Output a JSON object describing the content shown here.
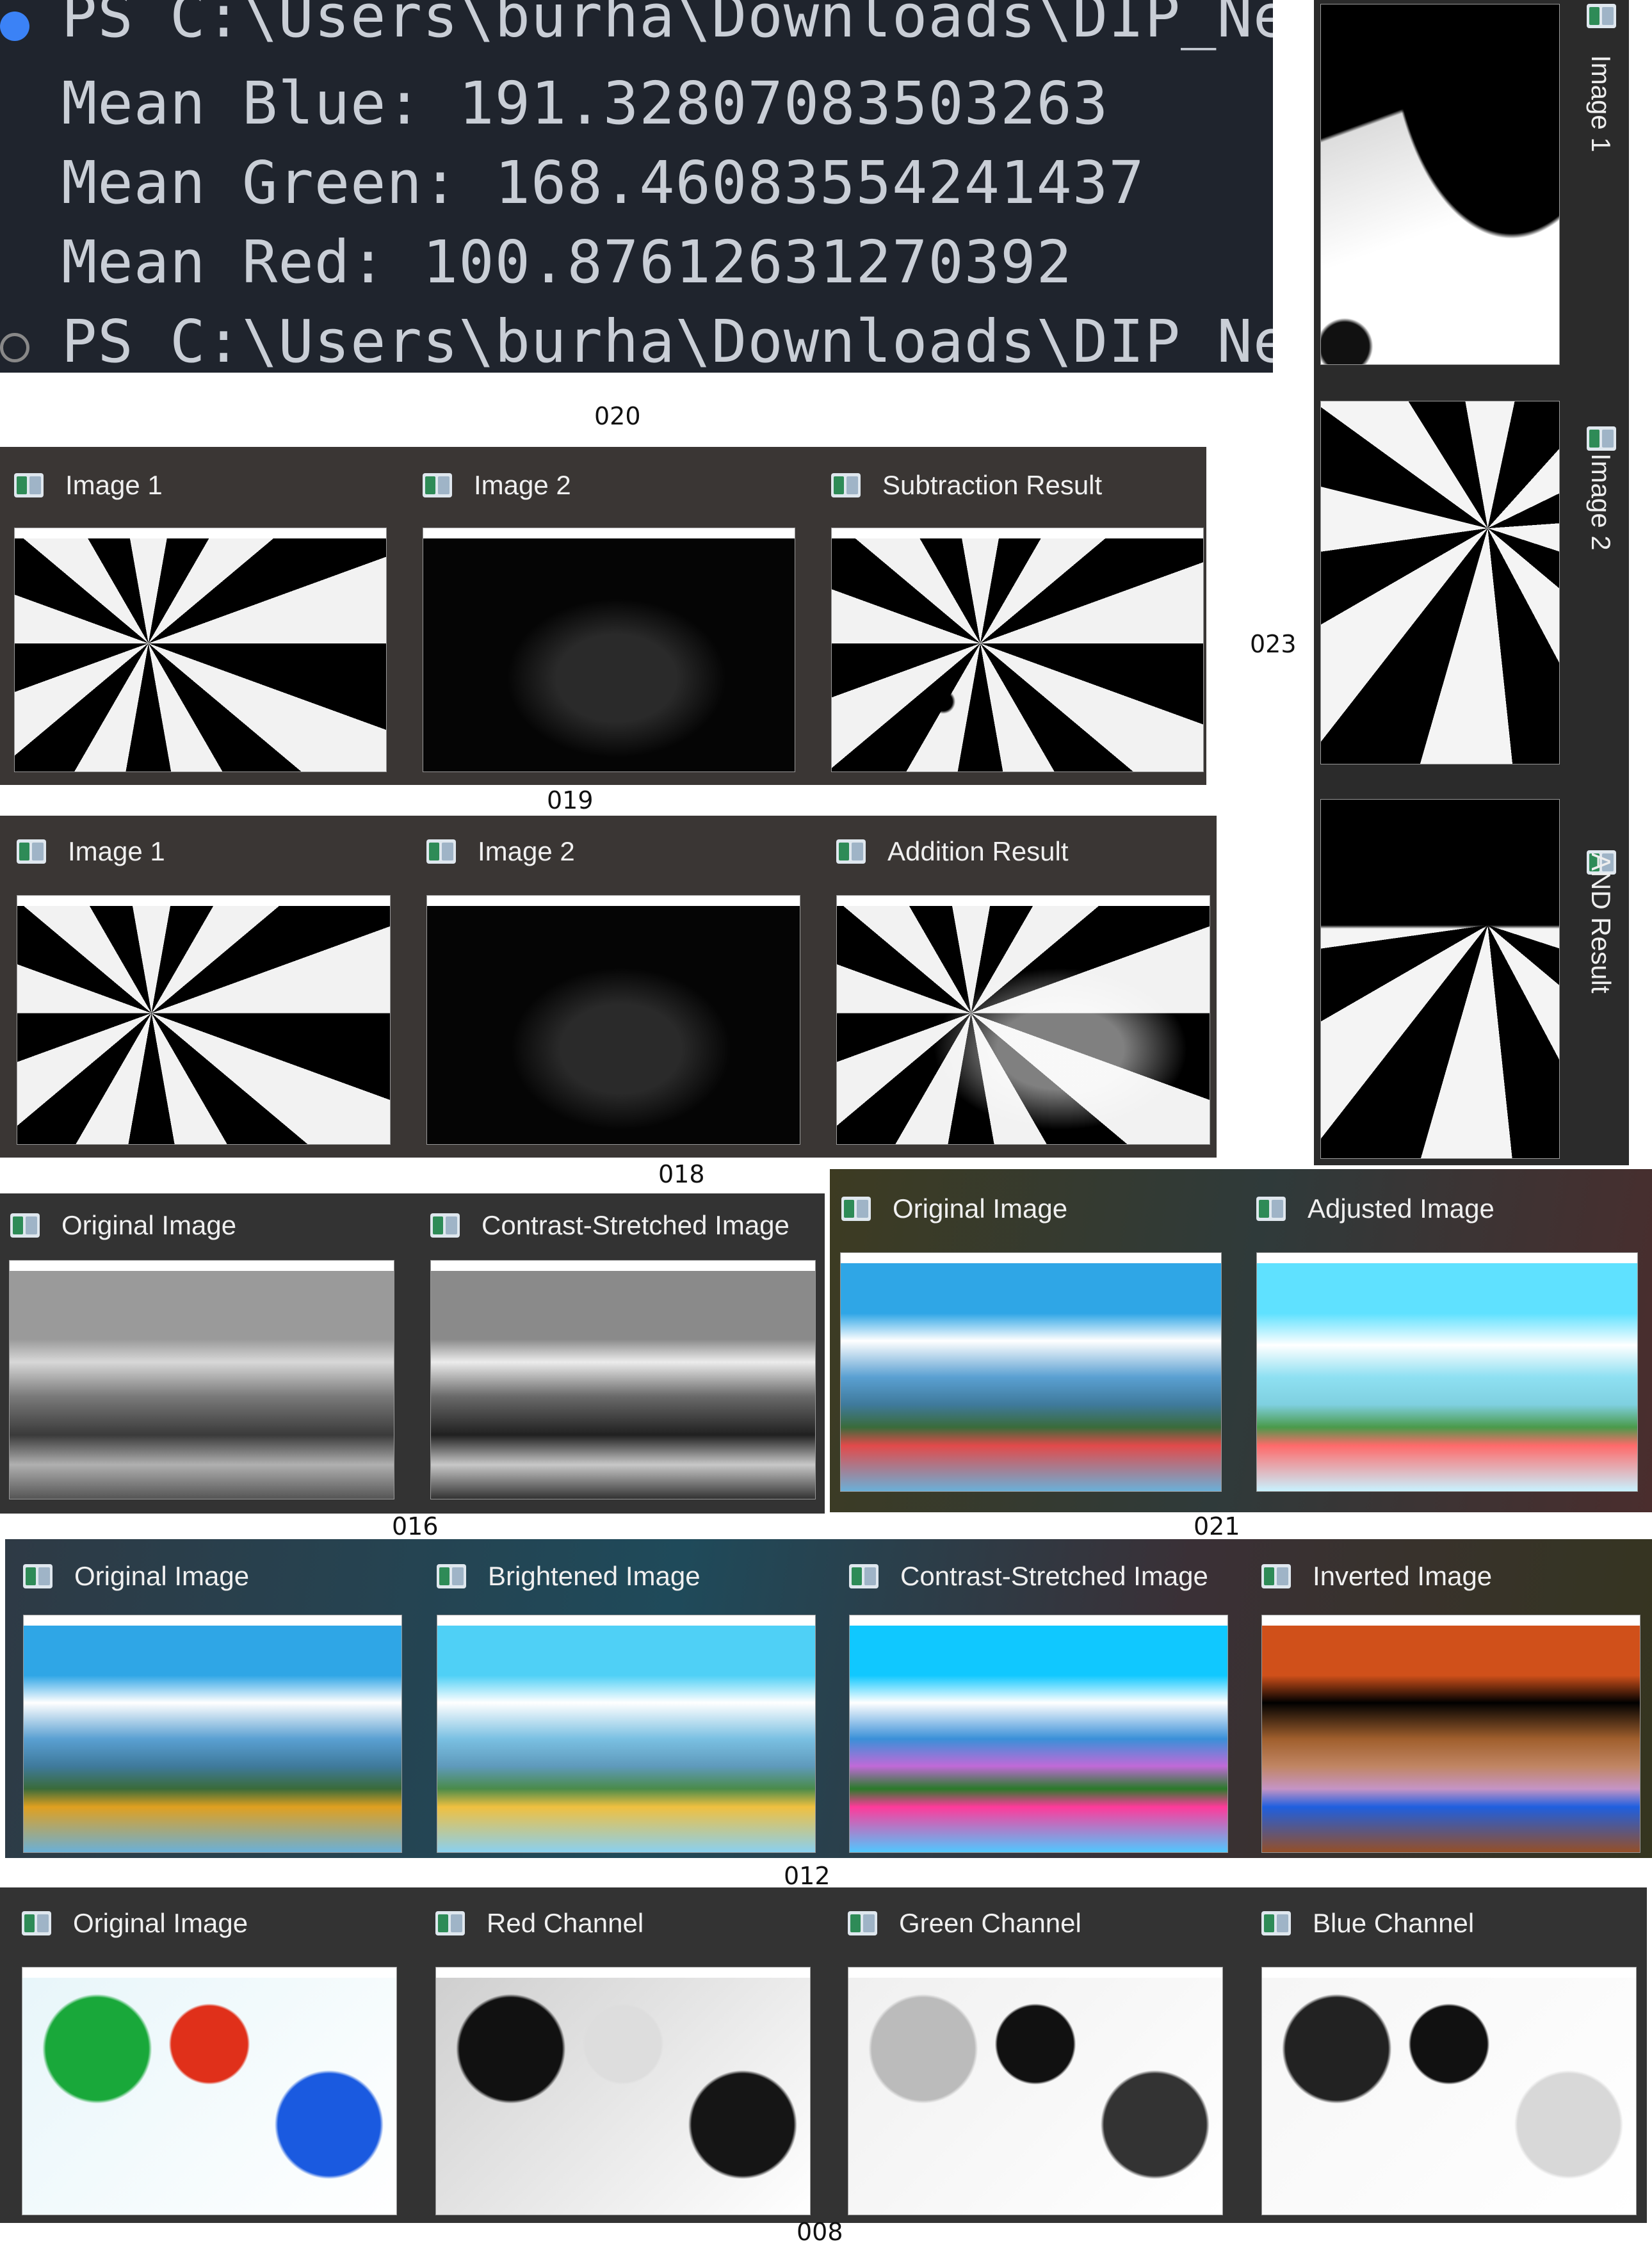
{
  "terminal": {
    "lines": [
      "PS C:\\Users\\burha\\Downloads\\DIP_Ne",
      "Mean Blue: 191.32807083503263",
      "Mean Green: 168.46083554241437",
      "Mean Red: 100.87612631270392",
      "PS C:\\Users\\burha\\Downloads\\DIP_Ne"
    ]
  },
  "captions": {
    "c020": "020",
    "c019": "019",
    "c018": "018",
    "c016": "016",
    "c021": "021",
    "c023": "023",
    "c012": "012",
    "c008": "008"
  },
  "panels": {
    "p019": [
      "Image 1",
      "Image 2",
      "Subtraction Result"
    ],
    "p018": [
      "Image 1",
      "Image 2",
      "Addition Result"
    ],
    "p016": [
      "Original Image",
      "Contrast-Stretched Image"
    ],
    "p021": [
      "Original Image",
      "Adjusted Image"
    ],
    "p023": [
      "Image 1",
      "Image 2",
      "AND Result"
    ],
    "p012": [
      "Original Image",
      "Brightened Image",
      "Contrast-Stretched Image",
      "Inverted Image"
    ],
    "p008": [
      "Original Image",
      "Red Channel",
      "Green Channel",
      "Blue Channel"
    ]
  },
  "icons": {
    "window": "opencv-window-icon",
    "bullet": "terminal-status-dot"
  }
}
